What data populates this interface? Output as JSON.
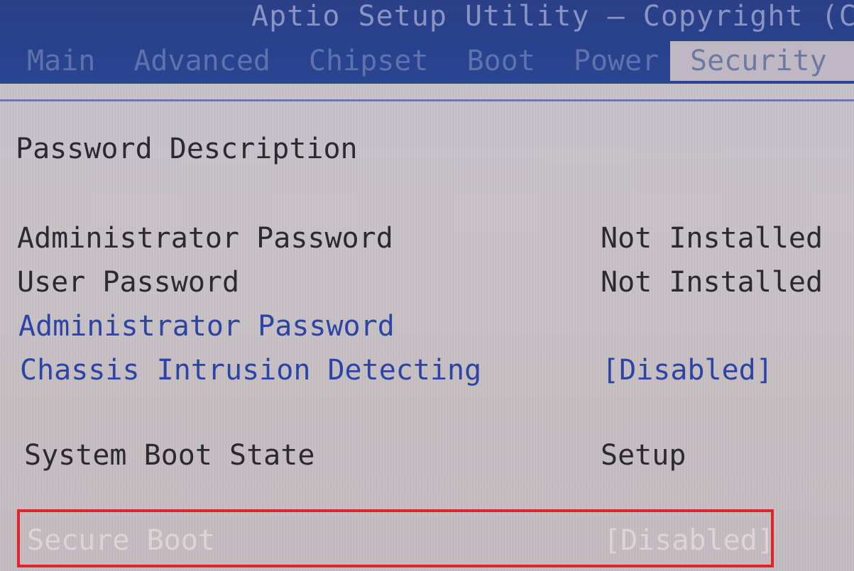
{
  "header": {
    "title": "Aptio Setup Utility – Copyright (C)",
    "tabs": [
      {
        "label": "Main",
        "active": false
      },
      {
        "label": "Advanced",
        "active": false
      },
      {
        "label": "Chipset",
        "active": false
      },
      {
        "label": "Boot",
        "active": false
      },
      {
        "label": "Power",
        "active": false
      },
      {
        "label": "Security",
        "active": true
      }
    ]
  },
  "security": {
    "section_title": "Password Description",
    "items": [
      {
        "label": "Administrator Password",
        "value": "Not Installed",
        "selectable": false
      },
      {
        "label": "User Password",
        "value": "Not Installed",
        "selectable": false
      },
      {
        "label": "Administrator Password",
        "value": "",
        "selectable": true
      },
      {
        "label": "Chassis Intrusion Detecting",
        "value": "[Disabled]",
        "selectable": true
      },
      {
        "label": "System Boot State",
        "value": "Setup",
        "selectable": false
      },
      {
        "label": "Secure Boot",
        "value": "[Disabled]",
        "selectable": true
      }
    ]
  },
  "colors": {
    "header_bg": "#28428e",
    "screen_bg": "#c6c2cc",
    "selectable_text": "#2b44a6",
    "static_text": "#2b2a32",
    "highlight_border": "#e0242b"
  }
}
